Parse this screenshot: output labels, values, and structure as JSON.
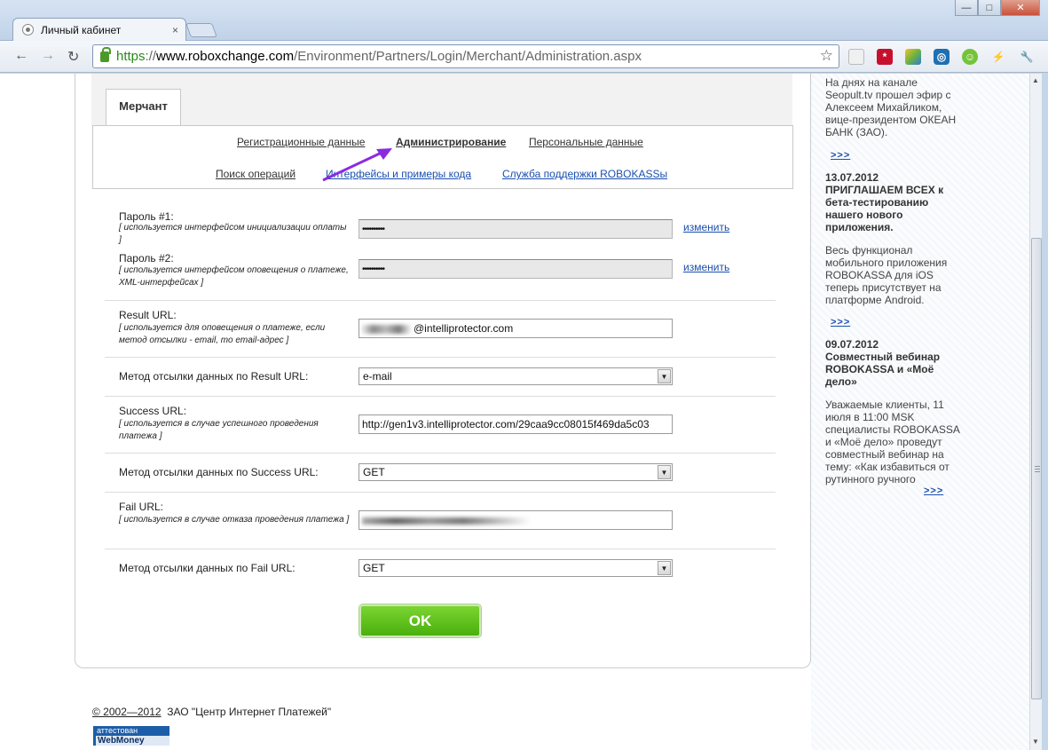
{
  "browser": {
    "tab_title": "Личный кабинет",
    "tab_close": "×",
    "url_scheme": "https",
    "url_sep": "://",
    "url_host": "www.roboxchange.com",
    "url_path": "/Environment/Partners/Login/Merchant/Administration.aspx",
    "controls": {
      "minimize": "—",
      "maximize": "□",
      "close": "✕"
    },
    "back": "←",
    "forward": "→",
    "reload": "↻",
    "star": "☆"
  },
  "merchant_tab": "Мерчант",
  "nav": {
    "registration": "Регистрационные данные",
    "administration": "Администрирование",
    "personal": "Персональные данные",
    "search_ops": "Поиск операций",
    "interfaces": "Интерфейсы и примеры кода",
    "support": "Служба поддержки ROBOKASSы"
  },
  "form": {
    "password1_label": "Пароль #1:",
    "password1_note": "[ используется интерфейсом инициализации оплаты ]",
    "password1_value": "••••••••••",
    "password2_label": "Пароль #2:",
    "password2_note": "[ используется интерфейсом оповещения о платеже, XML-интерфейсах ]",
    "password2_value": "••••••••••",
    "change_label": "изменить",
    "result_url_label": "Result URL:",
    "result_url_note": "[ используется для оповещения о платеже, если метод отсылки - email, то email-адрес ]",
    "result_url_value": "@intelliprotector.com",
    "result_method_label": "Метод отсылки данных по Result URL:",
    "result_method_value": "e-mail",
    "success_url_label": "Success URL:",
    "success_url_note": "[ используется в случае успешного проведения платежа ]",
    "success_url_value": "http://gen1v3.intelliprotector.com/29caa9cc08015f469da5c03",
    "success_method_label": "Метод отсылки данных по Success URL:",
    "success_method_value": "GET",
    "fail_url_label": "Fail URL:",
    "fail_url_note": "[ используется в случае отказа проведения платежа ]",
    "fail_method_label": "Метод отсылки данных по Fail URL:",
    "fail_method_value": "GET",
    "ok_label": "OK",
    "dropdown_icon": "▼"
  },
  "footer": {
    "copyright": "© 2002—2012",
    "company": "ЗАО \"Центр Интернет Платежей\"",
    "badge_line1": "аттестован",
    "badge_line2": "WebMoney"
  },
  "news": {
    "item0_text": "На днях на канале Seopult.tv прошел эфир с Алексеем Михайликом, вице-президентом ОКЕАН БАНК (ЗАО).",
    "more": ">>>",
    "item1_date": "13.07.2012",
    "item1_head": "ПРИГЛАШАЕМ ВСЕХ к бета-тестированию нашего нового приложения.",
    "item1_text": "Весь функционал мобильного приложения ROBOKASSA для iOS теперь присутствует на платформе Android.",
    "item2_date": "09.07.2012",
    "item2_head": "Совместный вебинар ROBOKASSA и «Моё дело»",
    "item2_text": "Уважаемые клиенты, 11 июля в 11:00 MSK специалисты ROBOKASSA и «Моё дело» проведут совместный вебинар на тему: «Как избавиться от рутинного ручного"
  },
  "colors": {
    "link": "#1a4fae",
    "ok_button": "#5cc11a",
    "arrow": "#8b2be0"
  },
  "icons": [
    "favicon-icon",
    "lock-icon",
    "star-icon",
    "extension-icons",
    "wrench-icon",
    "dropdown-arrow-icon",
    "annotation-arrow"
  ]
}
